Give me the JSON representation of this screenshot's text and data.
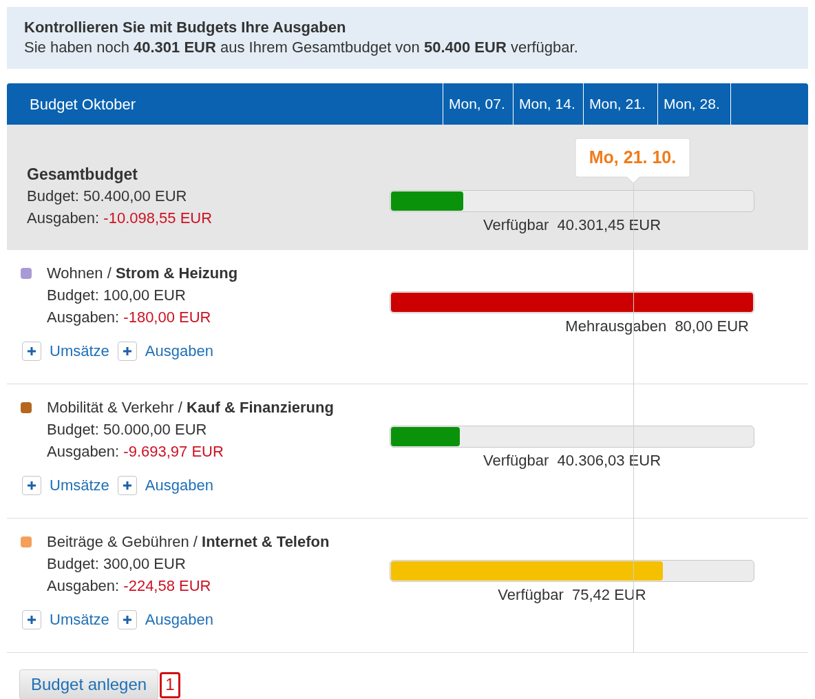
{
  "info": {
    "title": "Kontrollieren Sie mit Budgets Ihre Ausgaben",
    "text": "Sie haben noch **40.301 EUR** aus Ihrem Gesamtbudget von **50.400 EUR** verfügbar."
  },
  "header": {
    "title": "Budget Oktober",
    "weeks": [
      "Mon, 07.",
      "Mon, 14.",
      "Mon, 21.",
      "Mon, 28."
    ]
  },
  "total": {
    "title": "Gesamtbudget",
    "budget_label": "Budget:",
    "budget": "50.400,00 EUR",
    "expenses_label": "Ausgaben:",
    "expenses": "-10.098,55 EUR",
    "today_marker": "Mo, 21. 10.",
    "bar": {
      "kind": "ok",
      "level": 0.2,
      "label": "Verfügbar",
      "amount": "40.301,45 EUR"
    }
  },
  "budgets": [
    {
      "color": "#a99ad6",
      "group": "Wohnen /",
      "category": "Strom & Heizung",
      "budget_label": "Budget:",
      "budget": "100,00 EUR",
      "expenses_label": "Ausgaben:",
      "expenses": "-180,00 EUR",
      "bar": {
        "kind": "over",
        "level": 1,
        "label": "Mehrausgaben",
        "amount": "80,00 EUR"
      },
      "actions": [
        "Umsätze",
        "Ausgaben"
      ]
    },
    {
      "color": "#b5671f",
      "group": "Mobilität & Verkehr /",
      "category": "Kauf & Finanzierung",
      "budget_label": "Budget:",
      "budget": "50.000,00 EUR",
      "expenses_label": "Ausgaben:",
      "expenses": "-9.693,97 EUR",
      "bar": {
        "kind": "ok",
        "level": 0.19,
        "label": "Verfügbar",
        "amount": "40.306,03 EUR"
      },
      "actions": [
        "Umsätze",
        "Ausgaben"
      ]
    },
    {
      "color": "#f5a05a",
      "group": "Beiträge & Gebühren /",
      "category": "Internet & Telefon",
      "budget_label": "Budget:",
      "budget": "300,00 EUR",
      "expenses_label": "Ausgaben:",
      "expenses": "-224,58 EUR",
      "bar": {
        "kind": "warn",
        "level": 0.75,
        "label": "Verfügbar",
        "amount": "75,42 EUR"
      },
      "actions": [
        "Umsätze",
        "Ausgaben"
      ]
    }
  ],
  "create_button": {
    "label": "Budget anlegen",
    "badge": "1"
  }
}
